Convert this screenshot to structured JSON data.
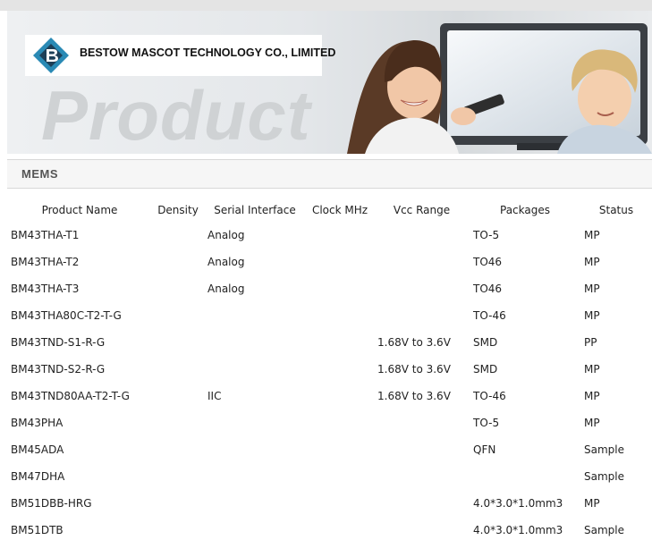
{
  "header": {
    "company_name": "BESTOW MASCOT TECHNOLOGY CO., LIMITED",
    "banner_watermark": "Product"
  },
  "category": {
    "title": "MEMS"
  },
  "table": {
    "columns": [
      "Product Name",
      "Density",
      "Serial Interface",
      "Clock MHz",
      "Vcc Range",
      "Packages",
      "Status"
    ],
    "rows": [
      [
        "BM43THA-T1",
        "",
        "Analog",
        "",
        "",
        "TO-5",
        "MP"
      ],
      [
        "BM43THA-T2",
        "",
        "Analog",
        "",
        "",
        "TO46",
        "MP"
      ],
      [
        "BM43THA-T3",
        "",
        "Analog",
        "",
        "",
        "TO46",
        "MP"
      ],
      [
        "BM43THA80C-T2-T-G",
        "",
        "",
        "",
        "",
        "TO-46",
        "MP"
      ],
      [
        "BM43TND-S1-R-G",
        "",
        "",
        "",
        "1.68V to 3.6V",
        "SMD",
        "PP"
      ],
      [
        "BM43TND-S2-R-G",
        "",
        "",
        "",
        "1.68V to 3.6V",
        "SMD",
        "MP"
      ],
      [
        "BM43TND80AA-T2-T-G",
        "",
        "IIC",
        "",
        "1.68V to 3.6V",
        "TO-46",
        "MP"
      ],
      [
        "BM43PHA",
        "",
        "",
        "",
        "",
        "TO-5",
        "MP"
      ],
      [
        "BM45ADA",
        "",
        "",
        "",
        "",
        "QFN",
        "Sample"
      ],
      [
        "BM47DHA",
        "",
        "",
        "",
        "",
        "",
        "Sample"
      ],
      [
        "BM51DBB-HRG",
        "",
        "",
        "",
        "",
        "4.0*3.0*1.0mm3",
        "MP"
      ],
      [
        "BM51DTB",
        "",
        "",
        "",
        "",
        "4.0*3.0*1.0mm3",
        "Sample"
      ]
    ]
  },
  "colors": {
    "logo_blue": "#2a8ab5",
    "logo_dark": "#1d3f57",
    "table_text": "#222222",
    "category_text": "#555555"
  },
  "icons": [
    "company-logo-icon"
  ]
}
